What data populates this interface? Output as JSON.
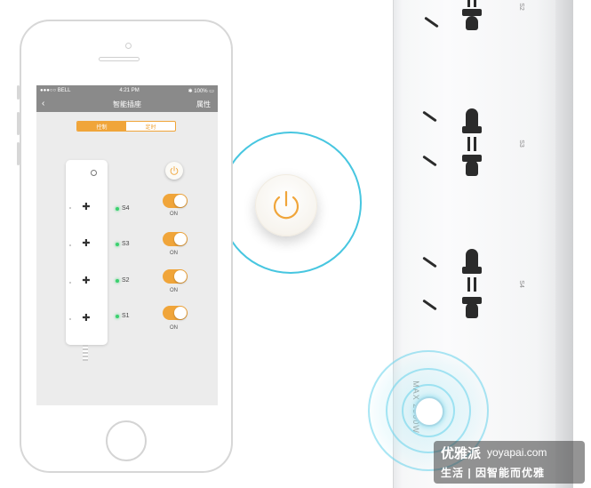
{
  "phone": {
    "status_bar": {
      "carrier": "●●●○○ BELL",
      "time": "4:21 PM",
      "battery": "100%"
    },
    "nav": {
      "back_icon": "chevron-left-icon",
      "title": "智能插座",
      "properties": "属性"
    },
    "segment": {
      "tabs": [
        "控制",
        "定时"
      ],
      "active": 0
    },
    "power_icon": "power-icon",
    "sockets": [
      {
        "label": "S4",
        "status": "ON",
        "on": true
      },
      {
        "label": "S3",
        "status": "ON",
        "on": true
      },
      {
        "label": "S2",
        "status": "ON",
        "on": true
      },
      {
        "label": "S1",
        "status": "ON",
        "on": true
      }
    ],
    "led_color": "#3bd16f",
    "accent_color": "#f0a53a"
  },
  "callout": {
    "icon": "power-icon",
    "accent_color": "#47c6e0"
  },
  "strip": {
    "socket_labels": [
      "S2",
      "S3",
      "S4"
    ],
    "max_label": "MAX 2500W"
  },
  "watermark": {
    "brand": "优雅派",
    "url": "yoyapai.com",
    "slogan": "生活 | 因智能而优雅"
  }
}
